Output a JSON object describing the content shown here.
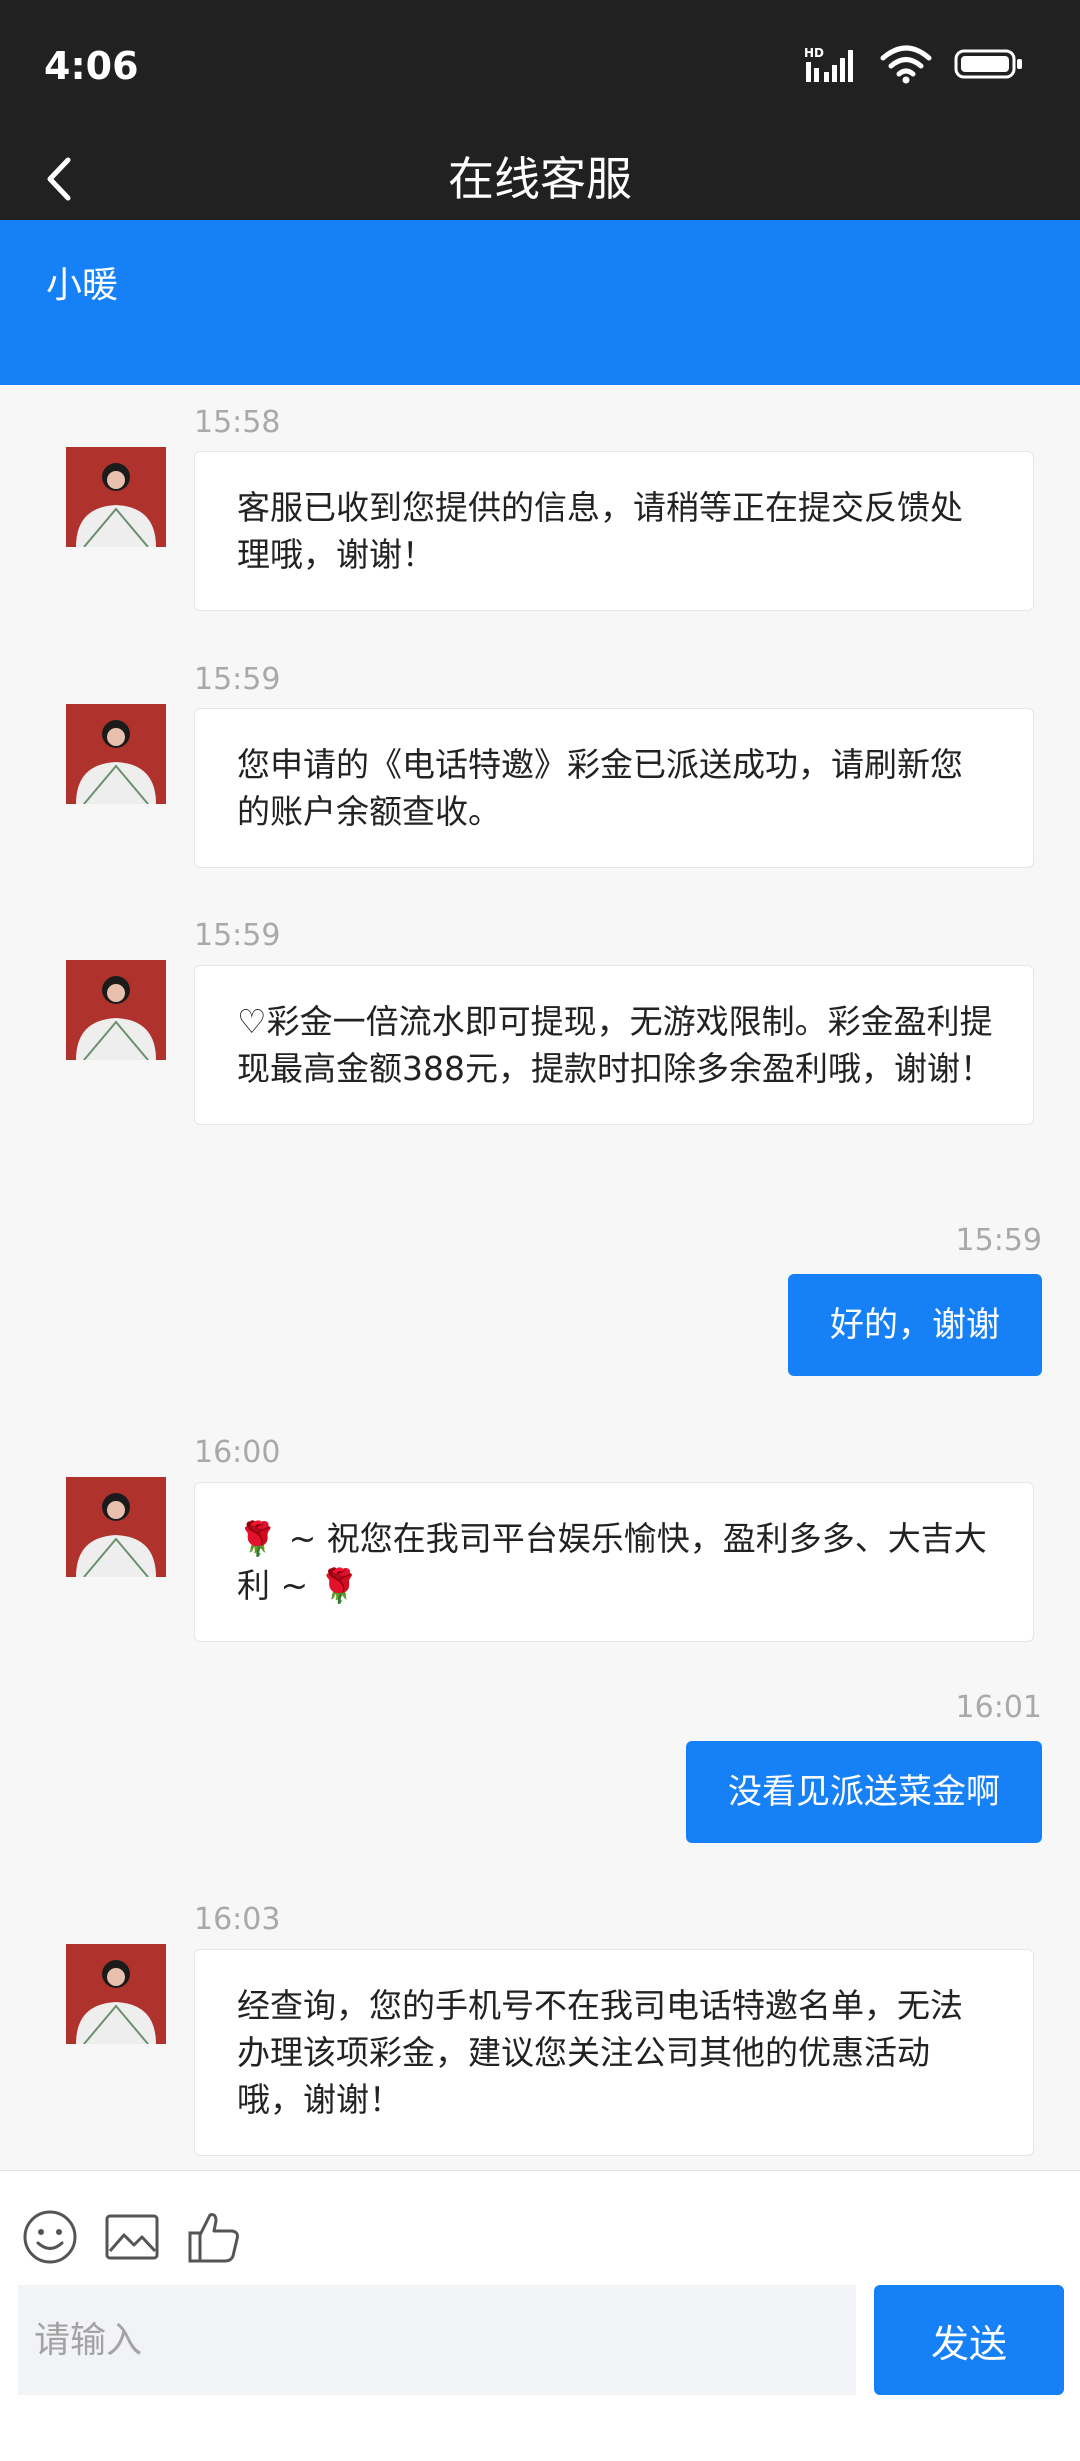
{
  "status_bar": {
    "time": "4:06",
    "network_label": "HD"
  },
  "header": {
    "title": "在线客服",
    "back_icon": "chevron-left-icon"
  },
  "agent": {
    "name": "小暖"
  },
  "messages": [
    {
      "side": "in",
      "time": "15:58",
      "text": "客服已收到您提供的信息，请稍等正在提交反馈处理哦，谢谢！"
    },
    {
      "side": "in",
      "time": "15:59",
      "text": "您申请的《电话特邀》彩金已派送成功，请刷新您的账户余额查收。"
    },
    {
      "side": "in",
      "time": "15:59",
      "text": "♡彩金一倍流水即可提现，无游戏限制。彩金盈利提现最高金额388元，提款时扣除多余盈利哦，谢谢！"
    },
    {
      "side": "out",
      "time": "15:59",
      "text": "好的，谢谢"
    },
    {
      "side": "in",
      "time": "16:00",
      "text": "🌹 ~ 祝您在我司平台娱乐愉快，盈利多多、大吉大利 ~ 🌹"
    },
    {
      "side": "out",
      "time": "16:01",
      "text": "没看见派送菜金啊"
    },
    {
      "side": "in",
      "time": "16:03",
      "text": "经查询，您的手机号不在我司电话特邀名单，无法办理该项彩金，建议您关注公司其他的优惠活动哦，谢谢！"
    }
  ],
  "input": {
    "placeholder": "请输入",
    "value": "",
    "send_label": "发送"
  },
  "toolbar": {
    "icons": [
      "emoji-icon",
      "image-icon",
      "thumbs-up-icon"
    ]
  },
  "colors": {
    "accent": "#1680f7",
    "header_bg": "#212121",
    "chat_bg": "#f7f7f8"
  }
}
